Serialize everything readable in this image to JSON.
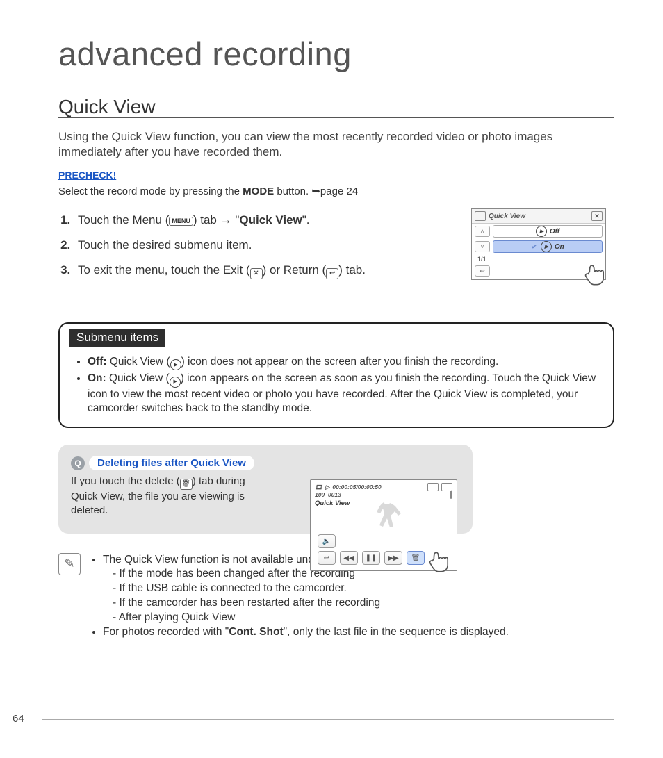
{
  "page_number": "64",
  "chapter_title": "advanced recording",
  "section_title": "Quick View",
  "intro": "Using the Quick View function, you can view the most recently recorded video or photo images immediately after you have recorded them.",
  "precheck": {
    "label": "PRECHECK!",
    "text_pre": "Select the record mode by pressing the ",
    "text_bold": "MODE",
    "text_post": " button. ➥page 24"
  },
  "steps": [
    {
      "pre": "Touch the Menu (",
      "icon": "MENU",
      "mid": ") tab → \"",
      "bold": "Quick View",
      "post": "\"."
    },
    {
      "full": "Touch the desired submenu item."
    },
    {
      "pre": "To exit the menu, touch the Exit (",
      "icon1": "✕",
      "mid": ") or Return (",
      "icon2": "↩",
      "post": ") tab."
    }
  ],
  "qv_screen": {
    "title": "Quick View",
    "off_label": "Off",
    "on_label": "On",
    "pager": "1/1"
  },
  "submenu": {
    "heading": "Submenu items",
    "off": {
      "label": "Off:",
      "text_pre": " Quick View (",
      "text_post": ") icon does not appear on the screen after you finish the recording."
    },
    "on": {
      "label": "On:",
      "text_pre": " Quick View (",
      "text_post": ") icon appears on the screen as soon as you finish the recording. Touch the Quick View icon to view the most recent video or photo you have recorded. After the Quick View is completed, your camcorder switches back to the standby mode."
    }
  },
  "tip": {
    "title": "Deleting files after Quick View",
    "body_pre": "If you touch the delete (",
    "body_post": ") tab during Quick View, the file you are viewing is deleted."
  },
  "play_screen": {
    "timecode": "00:00:05/00:00:50",
    "clip_id": "100_0013",
    "label": "Quick View"
  },
  "notes": {
    "lead": "The Quick View function is not available under the following conditions:",
    "items": [
      "If the mode has been changed after the recording",
      "If the USB cable is connected to the camcorder.",
      "If the camcorder has been restarted after the recording",
      "After playing Quick View"
    ],
    "photos_pre": "For photos recorded with \"",
    "photos_bold": "Cont. Shot",
    "photos_post": "\", only the last file in the sequence is displayed."
  }
}
